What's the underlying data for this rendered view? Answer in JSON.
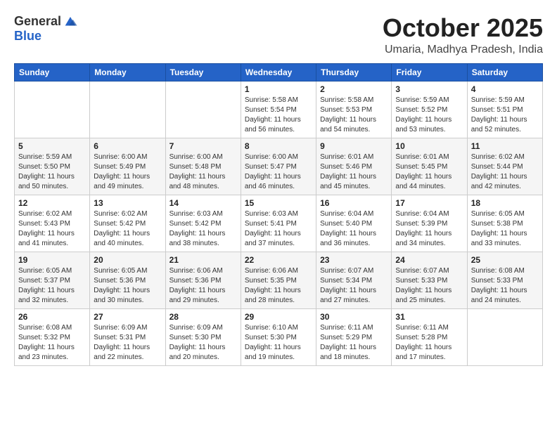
{
  "logo": {
    "text_general": "General",
    "text_blue": "Blue"
  },
  "title": {
    "month": "October 2025",
    "location": "Umaria, Madhya Pradesh, India"
  },
  "weekdays": [
    "Sunday",
    "Monday",
    "Tuesday",
    "Wednesday",
    "Thursday",
    "Friday",
    "Saturday"
  ],
  "weeks": [
    [
      {
        "day": "",
        "info": ""
      },
      {
        "day": "",
        "info": ""
      },
      {
        "day": "",
        "info": ""
      },
      {
        "day": "1",
        "info": "Sunrise: 5:58 AM\nSunset: 5:54 PM\nDaylight: 11 hours\nand 56 minutes."
      },
      {
        "day": "2",
        "info": "Sunrise: 5:58 AM\nSunset: 5:53 PM\nDaylight: 11 hours\nand 54 minutes."
      },
      {
        "day": "3",
        "info": "Sunrise: 5:59 AM\nSunset: 5:52 PM\nDaylight: 11 hours\nand 53 minutes."
      },
      {
        "day": "4",
        "info": "Sunrise: 5:59 AM\nSunset: 5:51 PM\nDaylight: 11 hours\nand 52 minutes."
      }
    ],
    [
      {
        "day": "5",
        "info": "Sunrise: 5:59 AM\nSunset: 5:50 PM\nDaylight: 11 hours\nand 50 minutes."
      },
      {
        "day": "6",
        "info": "Sunrise: 6:00 AM\nSunset: 5:49 PM\nDaylight: 11 hours\nand 49 minutes."
      },
      {
        "day": "7",
        "info": "Sunrise: 6:00 AM\nSunset: 5:48 PM\nDaylight: 11 hours\nand 48 minutes."
      },
      {
        "day": "8",
        "info": "Sunrise: 6:00 AM\nSunset: 5:47 PM\nDaylight: 11 hours\nand 46 minutes."
      },
      {
        "day": "9",
        "info": "Sunrise: 6:01 AM\nSunset: 5:46 PM\nDaylight: 11 hours\nand 45 minutes."
      },
      {
        "day": "10",
        "info": "Sunrise: 6:01 AM\nSunset: 5:45 PM\nDaylight: 11 hours\nand 44 minutes."
      },
      {
        "day": "11",
        "info": "Sunrise: 6:02 AM\nSunset: 5:44 PM\nDaylight: 11 hours\nand 42 minutes."
      }
    ],
    [
      {
        "day": "12",
        "info": "Sunrise: 6:02 AM\nSunset: 5:43 PM\nDaylight: 11 hours\nand 41 minutes."
      },
      {
        "day": "13",
        "info": "Sunrise: 6:02 AM\nSunset: 5:42 PM\nDaylight: 11 hours\nand 40 minutes."
      },
      {
        "day": "14",
        "info": "Sunrise: 6:03 AM\nSunset: 5:42 PM\nDaylight: 11 hours\nand 38 minutes."
      },
      {
        "day": "15",
        "info": "Sunrise: 6:03 AM\nSunset: 5:41 PM\nDaylight: 11 hours\nand 37 minutes."
      },
      {
        "day": "16",
        "info": "Sunrise: 6:04 AM\nSunset: 5:40 PM\nDaylight: 11 hours\nand 36 minutes."
      },
      {
        "day": "17",
        "info": "Sunrise: 6:04 AM\nSunset: 5:39 PM\nDaylight: 11 hours\nand 34 minutes."
      },
      {
        "day": "18",
        "info": "Sunrise: 6:05 AM\nSunset: 5:38 PM\nDaylight: 11 hours\nand 33 minutes."
      }
    ],
    [
      {
        "day": "19",
        "info": "Sunrise: 6:05 AM\nSunset: 5:37 PM\nDaylight: 11 hours\nand 32 minutes."
      },
      {
        "day": "20",
        "info": "Sunrise: 6:05 AM\nSunset: 5:36 PM\nDaylight: 11 hours\nand 30 minutes."
      },
      {
        "day": "21",
        "info": "Sunrise: 6:06 AM\nSunset: 5:36 PM\nDaylight: 11 hours\nand 29 minutes."
      },
      {
        "day": "22",
        "info": "Sunrise: 6:06 AM\nSunset: 5:35 PM\nDaylight: 11 hours\nand 28 minutes."
      },
      {
        "day": "23",
        "info": "Sunrise: 6:07 AM\nSunset: 5:34 PM\nDaylight: 11 hours\nand 27 minutes."
      },
      {
        "day": "24",
        "info": "Sunrise: 6:07 AM\nSunset: 5:33 PM\nDaylight: 11 hours\nand 25 minutes."
      },
      {
        "day": "25",
        "info": "Sunrise: 6:08 AM\nSunset: 5:33 PM\nDaylight: 11 hours\nand 24 minutes."
      }
    ],
    [
      {
        "day": "26",
        "info": "Sunrise: 6:08 AM\nSunset: 5:32 PM\nDaylight: 11 hours\nand 23 minutes."
      },
      {
        "day": "27",
        "info": "Sunrise: 6:09 AM\nSunset: 5:31 PM\nDaylight: 11 hours\nand 22 minutes."
      },
      {
        "day": "28",
        "info": "Sunrise: 6:09 AM\nSunset: 5:30 PM\nDaylight: 11 hours\nand 20 minutes."
      },
      {
        "day": "29",
        "info": "Sunrise: 6:10 AM\nSunset: 5:30 PM\nDaylight: 11 hours\nand 19 minutes."
      },
      {
        "day": "30",
        "info": "Sunrise: 6:11 AM\nSunset: 5:29 PM\nDaylight: 11 hours\nand 18 minutes."
      },
      {
        "day": "31",
        "info": "Sunrise: 6:11 AM\nSunset: 5:28 PM\nDaylight: 11 hours\nand 17 minutes."
      },
      {
        "day": "",
        "info": ""
      }
    ]
  ]
}
